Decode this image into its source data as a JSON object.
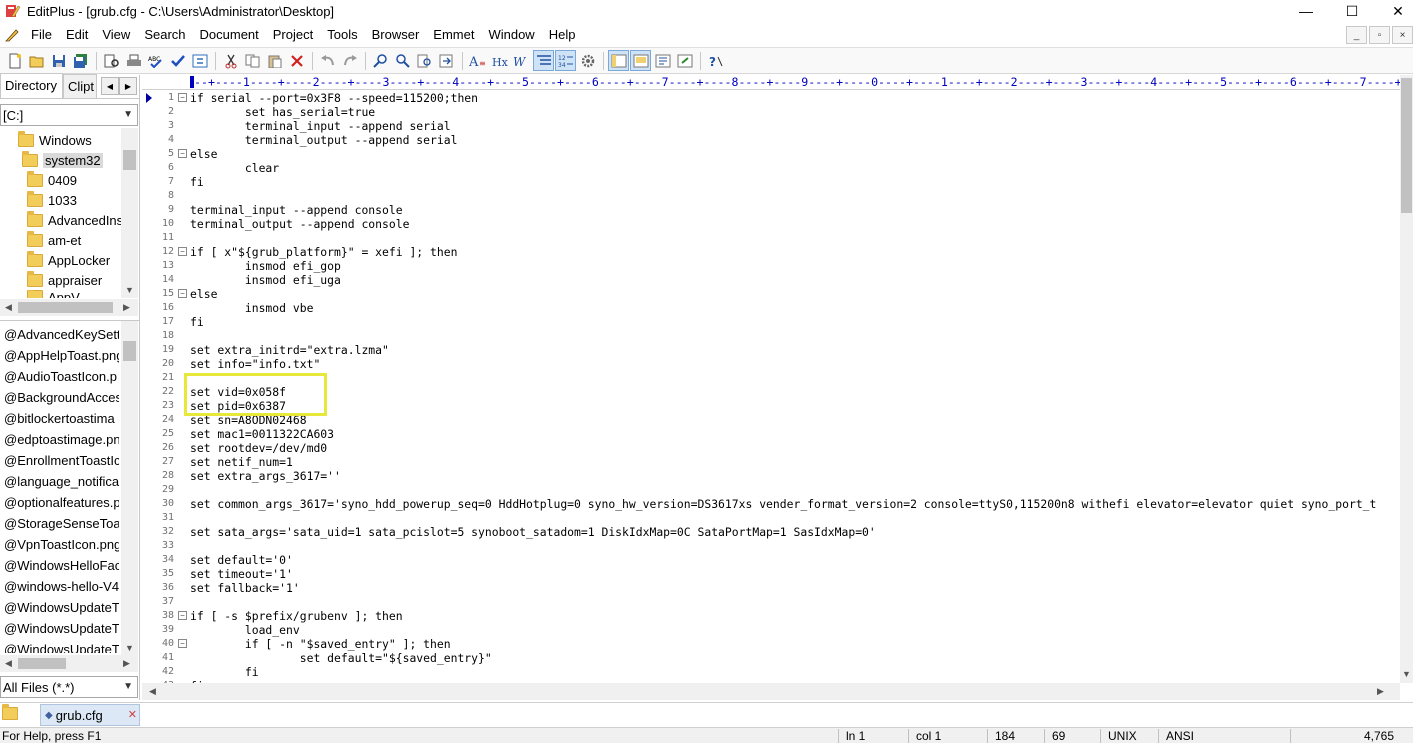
{
  "window": {
    "title": "EditPlus - [grub.cfg - C:\\Users\\Administrator\\Desktop]",
    "minimize": "—",
    "maximize": "☐",
    "close": "✕"
  },
  "menu": [
    "File",
    "Edit",
    "View",
    "Search",
    "Document",
    "Project",
    "Tools",
    "Browser",
    "Emmet",
    "Window",
    "Help"
  ],
  "mdi_buttons": [
    "_",
    "▫",
    "×"
  ],
  "toolbar_icons": [
    "new-file",
    "open",
    "save",
    "save-all",
    "print-preview",
    "print",
    "spell-check",
    "check",
    "sync",
    "cut",
    "copy",
    "paste",
    "delete",
    "undo",
    "redo",
    "find",
    "replace",
    "find-in-files",
    "goto",
    "bold-text",
    "heading",
    "word-wrap",
    "indent",
    "line-numbers",
    "settings",
    "view-1",
    "view-2",
    "view-3",
    "view-4",
    "help"
  ],
  "left": {
    "tabs": [
      "Directory",
      "Clipt"
    ],
    "drive": "[C:]",
    "tree": [
      {
        "label": "Windows",
        "level": 0
      },
      {
        "label": "system32",
        "level": 1,
        "selected": true
      },
      {
        "label": "0409",
        "level": 2
      },
      {
        "label": "1033",
        "level": 2
      },
      {
        "label": "AdvancedIns",
        "level": 2
      },
      {
        "label": "am-et",
        "level": 2
      },
      {
        "label": "AppLocker",
        "level": 2
      },
      {
        "label": "appraiser",
        "level": 2
      },
      {
        "label": "AppV",
        "level": 2
      }
    ],
    "files": [
      "@AdvancedKeySetti",
      "@AppHelpToast.png",
      "@AudioToastIcon.p",
      "@BackgroundAcces",
      "@bitlockertoastima",
      "@edptoastimage.pn",
      "@EnrollmentToastIc",
      "@language_notificat",
      "@optionalfeatures.p",
      "@StorageSenseToa",
      "@VpnToastIcon.png",
      "@WindowsHelloFac",
      "@windows-hello-V4",
      "@WindowsUpdateT",
      "@WindowsUpdateT",
      "@WindowsUpdateT"
    ],
    "filter": "All Files (*.*)"
  },
  "ruler": "--+----1----+----2----+----3----+----4----+----5----+----6----+----7----+----8----+----9----+----0----+----1----+----2----+----3----+----4----+----5----+----6----+----7----+",
  "editor": {
    "lines": [
      {
        "n": "1",
        "fold": "⊟",
        "text": "if serial --port=0x3F8 --speed=115200;then"
      },
      {
        "n": "2",
        "text": "        set has_serial=true"
      },
      {
        "n": "3",
        "text": "        terminal_input --append serial"
      },
      {
        "n": "4",
        "text": "        terminal_output --append serial"
      },
      {
        "n": "5",
        "fold": "⊟",
        "text": "else"
      },
      {
        "n": "6",
        "text": "        clear"
      },
      {
        "n": "7",
        "text": "fi"
      },
      {
        "n": "8",
        "text": ""
      },
      {
        "n": "9",
        "text": "terminal_input --append console"
      },
      {
        "n": "10",
        "text": "terminal_output --append console"
      },
      {
        "n": "11",
        "text": ""
      },
      {
        "n": "12",
        "fold": "⊟",
        "text": "if [ x\"${grub_platform}\" = xefi ]; then"
      },
      {
        "n": "13",
        "text": "        insmod efi_gop"
      },
      {
        "n": "14",
        "text": "        insmod efi_uga"
      },
      {
        "n": "15",
        "fold": "⊟",
        "text": "else"
      },
      {
        "n": "16",
        "text": "        insmod vbe"
      },
      {
        "n": "17",
        "text": "fi"
      },
      {
        "n": "18",
        "text": ""
      },
      {
        "n": "19",
        "text": "set extra_initrd=\"extra.lzma\""
      },
      {
        "n": "20",
        "text": "set info=\"info.txt\""
      },
      {
        "n": "21",
        "text": ""
      },
      {
        "n": "22",
        "text": "set vid=0x058f"
      },
      {
        "n": "23",
        "text": "set pid=0x6387"
      },
      {
        "n": "24",
        "text": "set sn=A8ODN02468"
      },
      {
        "n": "25",
        "text": "set mac1=0011322CA603"
      },
      {
        "n": "26",
        "text": "set rootdev=/dev/md0"
      },
      {
        "n": "27",
        "text": "set netif_num=1"
      },
      {
        "n": "28",
        "text": "set extra_args_3617=''"
      },
      {
        "n": "29",
        "text": ""
      },
      {
        "n": "30",
        "text": "set common_args_3617='syno_hdd_powerup_seq=0 HddHotplug=0 syno_hw_version=DS3617xs vender_format_version=2 console=ttyS0,115200n8 withefi elevator=elevator quiet syno_port_t"
      },
      {
        "n": "31",
        "text": ""
      },
      {
        "n": "32",
        "text": "set sata_args='sata_uid=1 sata_pcislot=5 synoboot_satadom=1 DiskIdxMap=0C SataPortMap=1 SasIdxMap=0'"
      },
      {
        "n": "33",
        "text": ""
      },
      {
        "n": "34",
        "text": "set default='0'"
      },
      {
        "n": "35",
        "text": "set timeout='1'"
      },
      {
        "n": "36",
        "text": "set fallback='1'"
      },
      {
        "n": "37",
        "text": ""
      },
      {
        "n": "38",
        "fold": "⊟",
        "text": "if [ -s $prefix/grubenv ]; then"
      },
      {
        "n": "39",
        "text": "        load_env"
      },
      {
        "n": "40",
        "fold": "⊟",
        "text": "        if [ -n \"$saved_entry\" ]; then"
      },
      {
        "n": "41",
        "text": "                set default=\"${saved_entry}\""
      },
      {
        "n": "42",
        "text": "        fi"
      },
      {
        "n": "43",
        "text": "fi"
      }
    ]
  },
  "doc_tab": {
    "label": "grub.cfg",
    "close": "✕"
  },
  "status": {
    "help": "For Help, press F1",
    "line": "ln 1",
    "col": "col 1",
    "chars": "184",
    "lines_count": "69",
    "format": "UNIX",
    "encoding": "ANSI",
    "size": "4,765"
  },
  "colors": {
    "highlight_box": "#e8e83a",
    "ruler": "#0000c0",
    "selected_tab": "#dce8f5"
  }
}
